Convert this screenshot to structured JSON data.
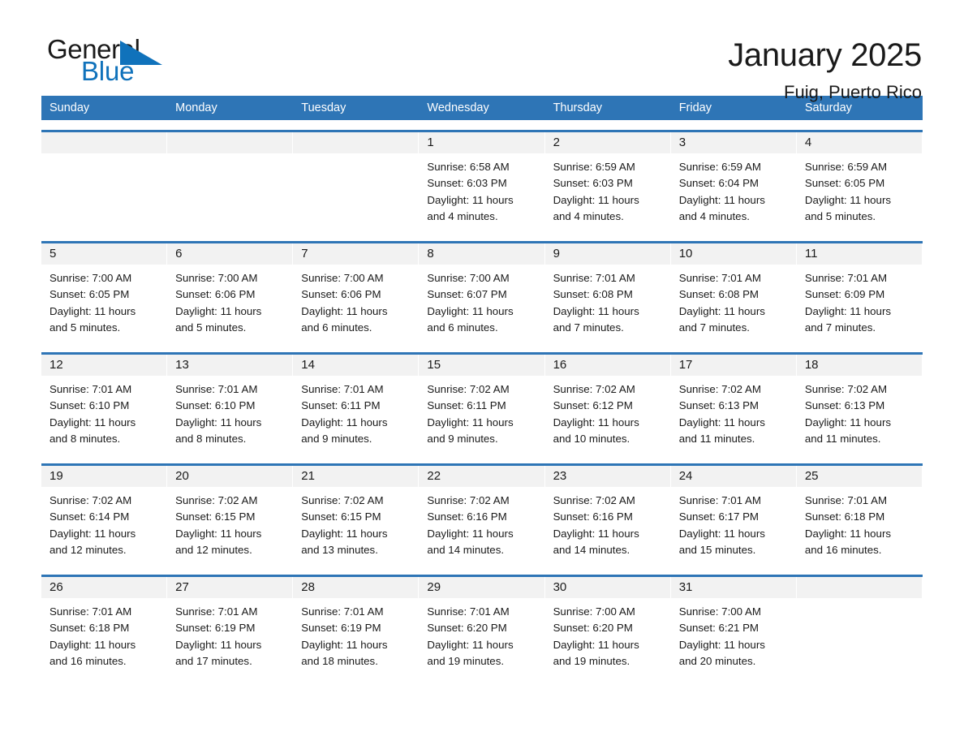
{
  "brand": {
    "name_part1": "General",
    "name_part2": "Blue",
    "triangle_icon": "triangle-icon",
    "accent_color": "#1072bb"
  },
  "header": {
    "title": "January 2025",
    "location": "Fuig, Puerto Rico"
  },
  "theme": {
    "header_band": "#2e75b6",
    "row_rule": "#2e75b6",
    "day_number_band": "#f2f2f2",
    "text": "#1a1a1a"
  },
  "weekdays": [
    "Sunday",
    "Monday",
    "Tuesday",
    "Wednesday",
    "Thursday",
    "Friday",
    "Saturday"
  ],
  "weeks": [
    [
      {
        "day": "",
        "sunrise": "",
        "sunset": "",
        "daylight_line1": "",
        "daylight_line2": ""
      },
      {
        "day": "",
        "sunrise": "",
        "sunset": "",
        "daylight_line1": "",
        "daylight_line2": ""
      },
      {
        "day": "",
        "sunrise": "",
        "sunset": "",
        "daylight_line1": "",
        "daylight_line2": ""
      },
      {
        "day": "1",
        "sunrise": "Sunrise: 6:58 AM",
        "sunset": "Sunset: 6:03 PM",
        "daylight_line1": "Daylight: 11 hours",
        "daylight_line2": "and 4 minutes."
      },
      {
        "day": "2",
        "sunrise": "Sunrise: 6:59 AM",
        "sunset": "Sunset: 6:03 PM",
        "daylight_line1": "Daylight: 11 hours",
        "daylight_line2": "and 4 minutes."
      },
      {
        "day": "3",
        "sunrise": "Sunrise: 6:59 AM",
        "sunset": "Sunset: 6:04 PM",
        "daylight_line1": "Daylight: 11 hours",
        "daylight_line2": "and 4 minutes."
      },
      {
        "day": "4",
        "sunrise": "Sunrise: 6:59 AM",
        "sunset": "Sunset: 6:05 PM",
        "daylight_line1": "Daylight: 11 hours",
        "daylight_line2": "and 5 minutes."
      }
    ],
    [
      {
        "day": "5",
        "sunrise": "Sunrise: 7:00 AM",
        "sunset": "Sunset: 6:05 PM",
        "daylight_line1": "Daylight: 11 hours",
        "daylight_line2": "and 5 minutes."
      },
      {
        "day": "6",
        "sunrise": "Sunrise: 7:00 AM",
        "sunset": "Sunset: 6:06 PM",
        "daylight_line1": "Daylight: 11 hours",
        "daylight_line2": "and 5 minutes."
      },
      {
        "day": "7",
        "sunrise": "Sunrise: 7:00 AM",
        "sunset": "Sunset: 6:06 PM",
        "daylight_line1": "Daylight: 11 hours",
        "daylight_line2": "and 6 minutes."
      },
      {
        "day": "8",
        "sunrise": "Sunrise: 7:00 AM",
        "sunset": "Sunset: 6:07 PM",
        "daylight_line1": "Daylight: 11 hours",
        "daylight_line2": "and 6 minutes."
      },
      {
        "day": "9",
        "sunrise": "Sunrise: 7:01 AM",
        "sunset": "Sunset: 6:08 PM",
        "daylight_line1": "Daylight: 11 hours",
        "daylight_line2": "and 7 minutes."
      },
      {
        "day": "10",
        "sunrise": "Sunrise: 7:01 AM",
        "sunset": "Sunset: 6:08 PM",
        "daylight_line1": "Daylight: 11 hours",
        "daylight_line2": "and 7 minutes."
      },
      {
        "day": "11",
        "sunrise": "Sunrise: 7:01 AM",
        "sunset": "Sunset: 6:09 PM",
        "daylight_line1": "Daylight: 11 hours",
        "daylight_line2": "and 7 minutes."
      }
    ],
    [
      {
        "day": "12",
        "sunrise": "Sunrise: 7:01 AM",
        "sunset": "Sunset: 6:10 PM",
        "daylight_line1": "Daylight: 11 hours",
        "daylight_line2": "and 8 minutes."
      },
      {
        "day": "13",
        "sunrise": "Sunrise: 7:01 AM",
        "sunset": "Sunset: 6:10 PM",
        "daylight_line1": "Daylight: 11 hours",
        "daylight_line2": "and 8 minutes."
      },
      {
        "day": "14",
        "sunrise": "Sunrise: 7:01 AM",
        "sunset": "Sunset: 6:11 PM",
        "daylight_line1": "Daylight: 11 hours",
        "daylight_line2": "and 9 minutes."
      },
      {
        "day": "15",
        "sunrise": "Sunrise: 7:02 AM",
        "sunset": "Sunset: 6:11 PM",
        "daylight_line1": "Daylight: 11 hours",
        "daylight_line2": "and 9 minutes."
      },
      {
        "day": "16",
        "sunrise": "Sunrise: 7:02 AM",
        "sunset": "Sunset: 6:12 PM",
        "daylight_line1": "Daylight: 11 hours",
        "daylight_line2": "and 10 minutes."
      },
      {
        "day": "17",
        "sunrise": "Sunrise: 7:02 AM",
        "sunset": "Sunset: 6:13 PM",
        "daylight_line1": "Daylight: 11 hours",
        "daylight_line2": "and 11 minutes."
      },
      {
        "day": "18",
        "sunrise": "Sunrise: 7:02 AM",
        "sunset": "Sunset: 6:13 PM",
        "daylight_line1": "Daylight: 11 hours",
        "daylight_line2": "and 11 minutes."
      }
    ],
    [
      {
        "day": "19",
        "sunrise": "Sunrise: 7:02 AM",
        "sunset": "Sunset: 6:14 PM",
        "daylight_line1": "Daylight: 11 hours",
        "daylight_line2": "and 12 minutes."
      },
      {
        "day": "20",
        "sunrise": "Sunrise: 7:02 AM",
        "sunset": "Sunset: 6:15 PM",
        "daylight_line1": "Daylight: 11 hours",
        "daylight_line2": "and 12 minutes."
      },
      {
        "day": "21",
        "sunrise": "Sunrise: 7:02 AM",
        "sunset": "Sunset: 6:15 PM",
        "daylight_line1": "Daylight: 11 hours",
        "daylight_line2": "and 13 minutes."
      },
      {
        "day": "22",
        "sunrise": "Sunrise: 7:02 AM",
        "sunset": "Sunset: 6:16 PM",
        "daylight_line1": "Daylight: 11 hours",
        "daylight_line2": "and 14 minutes."
      },
      {
        "day": "23",
        "sunrise": "Sunrise: 7:02 AM",
        "sunset": "Sunset: 6:16 PM",
        "daylight_line1": "Daylight: 11 hours",
        "daylight_line2": "and 14 minutes."
      },
      {
        "day": "24",
        "sunrise": "Sunrise: 7:01 AM",
        "sunset": "Sunset: 6:17 PM",
        "daylight_line1": "Daylight: 11 hours",
        "daylight_line2": "and 15 minutes."
      },
      {
        "day": "25",
        "sunrise": "Sunrise: 7:01 AM",
        "sunset": "Sunset: 6:18 PM",
        "daylight_line1": "Daylight: 11 hours",
        "daylight_line2": "and 16 minutes."
      }
    ],
    [
      {
        "day": "26",
        "sunrise": "Sunrise: 7:01 AM",
        "sunset": "Sunset: 6:18 PM",
        "daylight_line1": "Daylight: 11 hours",
        "daylight_line2": "and 16 minutes."
      },
      {
        "day": "27",
        "sunrise": "Sunrise: 7:01 AM",
        "sunset": "Sunset: 6:19 PM",
        "daylight_line1": "Daylight: 11 hours",
        "daylight_line2": "and 17 minutes."
      },
      {
        "day": "28",
        "sunrise": "Sunrise: 7:01 AM",
        "sunset": "Sunset: 6:19 PM",
        "daylight_line1": "Daylight: 11 hours",
        "daylight_line2": "and 18 minutes."
      },
      {
        "day": "29",
        "sunrise": "Sunrise: 7:01 AM",
        "sunset": "Sunset: 6:20 PM",
        "daylight_line1": "Daylight: 11 hours",
        "daylight_line2": "and 19 minutes."
      },
      {
        "day": "30",
        "sunrise": "Sunrise: 7:00 AM",
        "sunset": "Sunset: 6:20 PM",
        "daylight_line1": "Daylight: 11 hours",
        "daylight_line2": "and 19 minutes."
      },
      {
        "day": "31",
        "sunrise": "Sunrise: 7:00 AM",
        "sunset": "Sunset: 6:21 PM",
        "daylight_line1": "Daylight: 11 hours",
        "daylight_line2": "and 20 minutes."
      },
      {
        "day": "",
        "sunrise": "",
        "sunset": "",
        "daylight_line1": "",
        "daylight_line2": ""
      }
    ]
  ]
}
